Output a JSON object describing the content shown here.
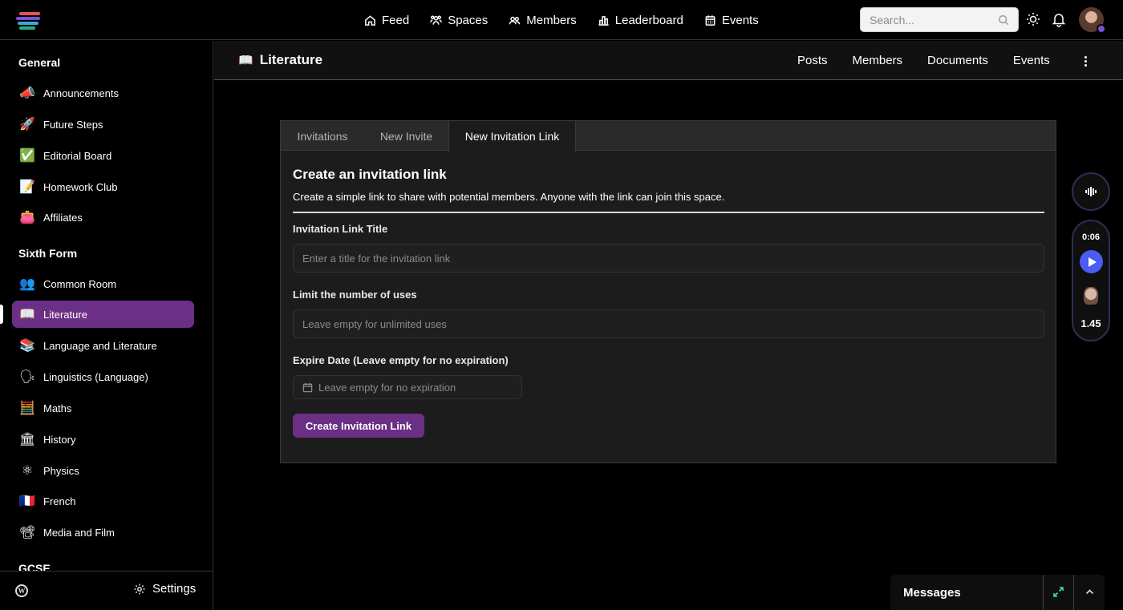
{
  "topnav": {
    "items": [
      {
        "label": "Feed",
        "icon": "home-icon"
      },
      {
        "label": "Spaces",
        "icon": "spaces-icon"
      },
      {
        "label": "Members",
        "icon": "members-icon"
      },
      {
        "label": "Leaderboard",
        "icon": "leaderboard-icon"
      },
      {
        "label": "Events",
        "icon": "calendar-icon"
      }
    ],
    "search_placeholder": "Search..."
  },
  "sidebar": {
    "sections": [
      "General",
      "Sixth Form",
      "GCSE"
    ],
    "items": [
      {
        "label": "Announcements",
        "emoji": "📣"
      },
      {
        "label": "Future Steps",
        "emoji": "🚀"
      },
      {
        "label": "Editorial Board",
        "emoji": "✅"
      },
      {
        "label": "Homework Club",
        "emoji": "📝"
      },
      {
        "label": "Affiliates",
        "emoji": "👛"
      },
      {
        "label": "Common Room",
        "emoji": "👥"
      },
      {
        "label": "Literature",
        "emoji": "📖"
      },
      {
        "label": "Language and Literature",
        "emoji": "📚"
      },
      {
        "label": "Linguistics (Language)",
        "emoji": "🗣"
      },
      {
        "label": "Maths",
        "emoji": "🧮"
      },
      {
        "label": "History",
        "emoji": "🏛"
      },
      {
        "label": "Physics",
        "emoji": "⚛"
      },
      {
        "label": "French",
        "emoji": "🇫🇷"
      },
      {
        "label": "Media and Film",
        "emoji": "📽"
      }
    ],
    "active_item": "Literature",
    "settings_label": "Settings"
  },
  "space": {
    "icon": "📖",
    "title": "Literature",
    "tabs": [
      "Posts",
      "Members",
      "Documents",
      "Events"
    ]
  },
  "form": {
    "tabs": [
      "Invitations",
      "New Invite",
      "New Invitation Link"
    ],
    "active_tab": "New Invitation Link",
    "title": "Create an invitation link",
    "description": "Create a simple link to share with potential members. Anyone with the link can join this space.",
    "link_title_label": "Invitation Link Title",
    "link_title_placeholder": "Enter a title for the invitation link",
    "limit_label": "Limit the number of uses",
    "limit_placeholder": "Leave empty for unlimited uses",
    "expire_label": "Expire Date (Leave empty for no expiration)",
    "expire_placeholder": "Leave empty for no expiration",
    "submit_label": "Create Invitation Link"
  },
  "player": {
    "time": "0:06",
    "speed": "1.45"
  },
  "messages": {
    "title": "Messages"
  },
  "colors": {
    "accent": "#6b2f86",
    "play_button": "#4b5cf0",
    "expand_icon": "#3bd7c2"
  }
}
